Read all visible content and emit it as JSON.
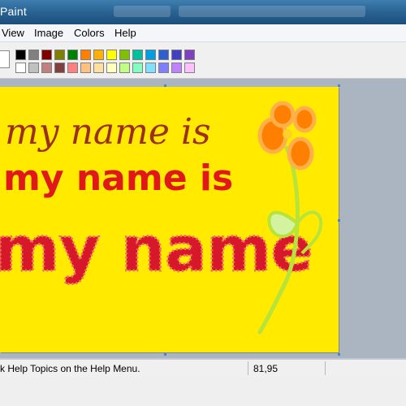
{
  "window": {
    "title": "Paint"
  },
  "menu": [
    "View",
    "Image",
    "Colors",
    "Help"
  ],
  "palette": {
    "row1": [
      "#000000",
      "#808080",
      "#800000",
      "#808000",
      "#008000",
      "#ff8000",
      "#ffb000",
      "#ffff00",
      "#80c000",
      "#00c0a0",
      "#00a0e0",
      "#3060d0",
      "#4040c0",
      "#8040c0"
    ],
    "row2": [
      "#ffffff",
      "#c0c0c0",
      "#c08080",
      "#804040",
      "#ff8080",
      "#ffc080",
      "#ffe0a0",
      "#ffffc0",
      "#c0ff80",
      "#80ffc0",
      "#80e0ff",
      "#8080ff",
      "#c080ff",
      "#ffc0ff"
    ],
    "row1_dark": [
      "#000000",
      "#7f7f7f",
      "#880015",
      "#ed1c24",
      "#ff7f27",
      "#fff200",
      "#22b14c",
      "#00a2e8",
      "#3f48cc",
      "#a349a4"
    ]
  },
  "canvas": {
    "background": "#ffea00",
    "text_lines": [
      "my name is",
      "my name is",
      "my name"
    ],
    "colors": {
      "line1": "#9b2f1c",
      "line2": "#e01818",
      "line3": "#d7182a",
      "flower": "#ff7f00",
      "stem": "#b7e33a"
    }
  },
  "status": {
    "help_text": "k Help Topics on the Help Menu.",
    "coords": "81,95"
  }
}
